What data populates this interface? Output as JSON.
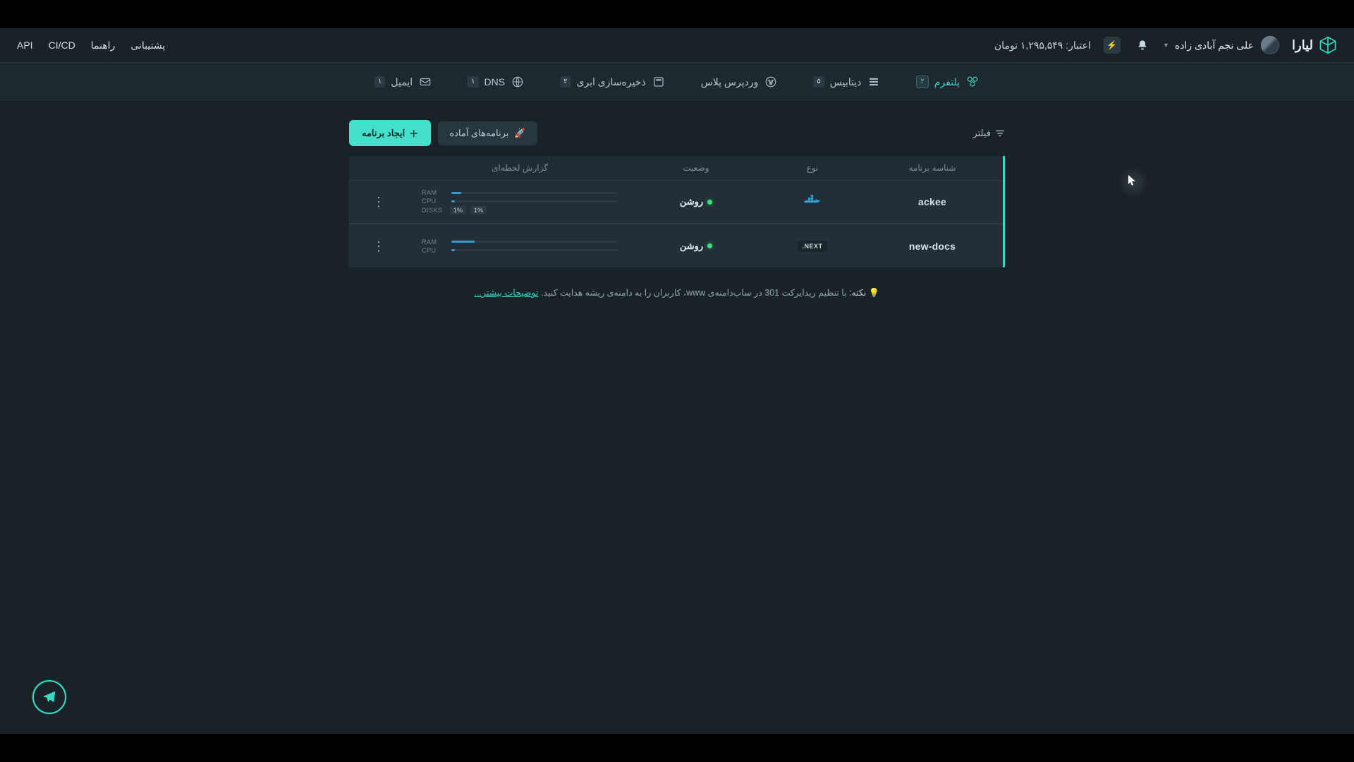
{
  "brand": {
    "name": "لیارا"
  },
  "header": {
    "user_name": "علی نجم آبادی زاده",
    "credit_label": "اعتبار: ۱,۲۹۵,۵۴۹ تومان",
    "nav": {
      "support": "پشتیبانی",
      "help": "راهنما",
      "cicd": "CI/CD",
      "api": "API"
    }
  },
  "subnav": {
    "platform": {
      "label": "پلتفرم",
      "count": "۲"
    },
    "database": {
      "label": "دیتابیس",
      "count": "۵"
    },
    "wordpress": {
      "label": "وردپرس پلاس"
    },
    "storage": {
      "label": "ذخیره‌سازی ابری",
      "count": "۲"
    },
    "dns": {
      "label": "DNS",
      "count": "۱"
    },
    "email": {
      "label": "ایمیل",
      "count": "۱"
    }
  },
  "toolbar": {
    "filter_label": "فیلتر",
    "ready_apps_label": "برنامه‌های آماده",
    "create_app_label": "ایجاد برنامه"
  },
  "table": {
    "headers": {
      "id": "شناسه برنامه",
      "type": "نوع",
      "status": "وضعیت",
      "report": "گزارش لحظه‌ای"
    },
    "rows": [
      {
        "id": "ackee",
        "type": "docker",
        "status_label": "روشن",
        "metrics": {
          "ram_label": "RAM",
          "ram_pct": 6,
          "cpu_label": "CPU",
          "cpu_pct": 2,
          "disks_label": "DISKS",
          "disk_vals": [
            "1%",
            "1%"
          ]
        }
      },
      {
        "id": "new-docs",
        "type": "next",
        "type_badge_text": "NEXT.",
        "status_label": "روشن",
        "metrics": {
          "ram_label": "RAM",
          "ram_pct": 14,
          "cpu_label": "CPU",
          "cpu_pct": 2
        }
      }
    ]
  },
  "tip": {
    "icon_prefix": "💡",
    "lead": "نکته:",
    "body": "با تنظیم ریدایرکت 301 در ساب‌دامنه‌ی www، کاربران را به دامنه‌ی ریشه هدایت کنید.",
    "link": "توضیحات بیشتر..."
  }
}
